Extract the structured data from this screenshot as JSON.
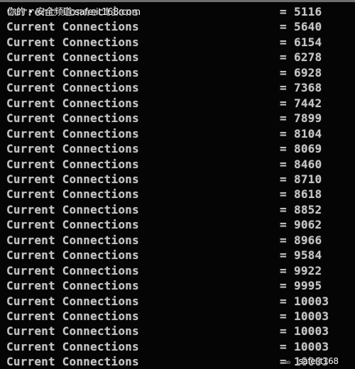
{
  "console": {
    "label": "Current Connections",
    "separator": "=",
    "rows": [
      {
        "label": "Current Connections",
        "value": "5116"
      },
      {
        "label": "Current Connections",
        "value": "5640"
      },
      {
        "label": "Current Connections",
        "value": "6154"
      },
      {
        "label": "Current Connections",
        "value": "6278"
      },
      {
        "label": "Current Connections",
        "value": "6928"
      },
      {
        "label": "Current Connections",
        "value": "7368"
      },
      {
        "label": "Current Connections",
        "value": "7442"
      },
      {
        "label": "Current Connections",
        "value": "7899"
      },
      {
        "label": "Current Connections",
        "value": "8104"
      },
      {
        "label": "Current Connections",
        "value": "8069"
      },
      {
        "label": "Current Connections",
        "value": "8460"
      },
      {
        "label": "Current Connections",
        "value": "8710"
      },
      {
        "label": "Current Connections",
        "value": "8618"
      },
      {
        "label": "Current Connections",
        "value": "8852"
      },
      {
        "label": "Current Connections",
        "value": "9062"
      },
      {
        "label": "Current Connections",
        "value": "8966"
      },
      {
        "label": "Current Connections",
        "value": "9584"
      },
      {
        "label": "Current Connections",
        "value": "9922"
      },
      {
        "label": "Current Connections",
        "value": "9995"
      },
      {
        "label": "Current Connections",
        "value": "10003"
      },
      {
        "label": "Current Connections",
        "value": "10003"
      },
      {
        "label": "Current Connections",
        "value": "10003"
      },
      {
        "label": "Current Connections",
        "value": "10003"
      },
      {
        "label": "Current Connections",
        "value": "10003"
      }
    ]
  },
  "watermarks": {
    "top": "你的 • 安全频道  safe.it168.com",
    "bottom_logo": "it0",
    "bottom": "safe.it168"
  },
  "colors": {
    "background": "#050505",
    "text": "#c4c4c4",
    "top_border": "#6e6e6e"
  }
}
